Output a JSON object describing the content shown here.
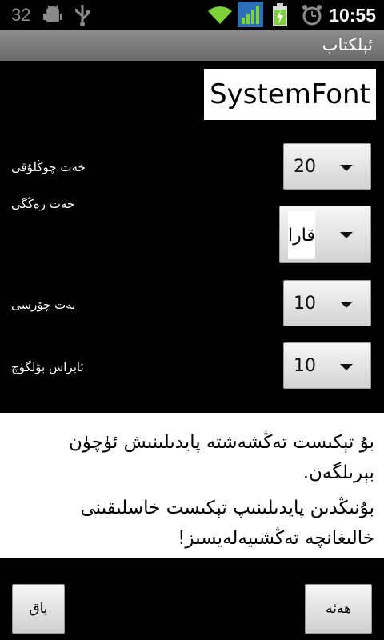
{
  "status_bar": {
    "notification_count": "32",
    "time": "10:55",
    "icons": [
      "android-debug-icon",
      "usb-icon",
      "wifi-icon",
      "signal-icon",
      "battery-charging-icon",
      "alarm-clock-icon"
    ]
  },
  "title_bar": {
    "title": "ئېلكتاب"
  },
  "font_name": "SystemFont",
  "settings": {
    "font_size": {
      "label": "خەت چوڭلۇقى",
      "value": "20"
    },
    "font_color": {
      "label": "خەت رەڭگى",
      "value": "قارا"
    },
    "page_padding": {
      "label": "بەت چۆرسى",
      "value": "10"
    },
    "paragraph_spacing": {
      "label": "ئابزاس بۆلگۈچ",
      "value": "10"
    }
  },
  "preview": {
    "paragraph1": "بۇ تېكىست تەڭشەشتە پايدىلىنىش ئۈچۈن بېرىلگەن.",
    "paragraph2": "بۇنىڭدىن پايدىلىنىپ تېكىست خاسلىقىنى خالىغانچە تەڭشىيەلەيسىز!"
  },
  "buttons": {
    "cancel": "ياق",
    "ok": "ھەئە"
  },
  "colors": {
    "background": "#000000",
    "title_bar": "#7a7a7a",
    "preview_bg": "#ffffff",
    "wifi": "#7fd13b",
    "signal": "#7fd13b"
  }
}
